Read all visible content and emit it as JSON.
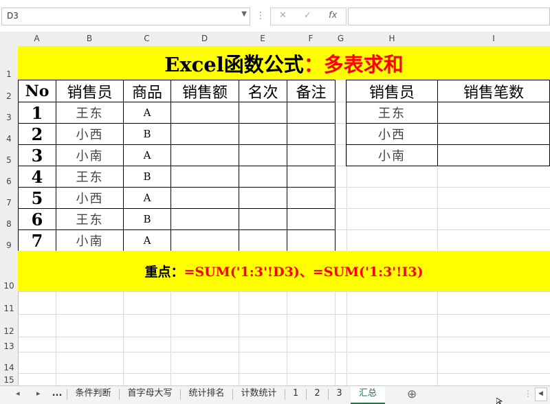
{
  "formula_bar": {
    "name_box": "D3",
    "cancel_icon": "✕",
    "enter_icon": "✓",
    "fx_label": "fx",
    "formula": ""
  },
  "columns": [
    "A",
    "B",
    "C",
    "D",
    "E",
    "F",
    "G",
    "H",
    "I"
  ],
  "rows": [
    "1",
    "2",
    "3",
    "4",
    "5",
    "6",
    "7",
    "8",
    "9",
    "10",
    "11",
    "12",
    "13",
    "14",
    "15"
  ],
  "sheet": {
    "title_part1": "Excel函数公式",
    "title_part2": "：多表求和",
    "title_color1": "#000000",
    "title_color2": "#ff0000",
    "highlight_color": "#ffff00",
    "headers_left": [
      "No",
      "销售员",
      "商品",
      "销售额",
      "名次",
      "备注"
    ],
    "headers_right": [
      "销售员",
      "销售笔数"
    ],
    "table": [
      {
        "no": "1",
        "name": "王东",
        "product": "A"
      },
      {
        "no": "2",
        "name": "小西",
        "product": "B"
      },
      {
        "no": "3",
        "name": "小南",
        "product": "A"
      },
      {
        "no": "4",
        "name": "王东",
        "product": "B"
      },
      {
        "no": "5",
        "name": "小西",
        "product": "A"
      },
      {
        "no": "6",
        "name": "王东",
        "product": "B"
      },
      {
        "no": "7",
        "name": "小南",
        "product": "A"
      }
    ],
    "summary_names": [
      "王东",
      "小西",
      "小南"
    ],
    "note_label": "重点：",
    "note_formula": "=SUM('1:3'!D3)、=SUM('1:3'!I3)"
  },
  "tabs": {
    "ellipsis": "...",
    "items": [
      "条件判断",
      "首字母大写",
      "统计排名",
      "计数统计",
      "1",
      "2",
      "3",
      "汇总"
    ],
    "active": "汇总",
    "add_icon": "⊕"
  }
}
